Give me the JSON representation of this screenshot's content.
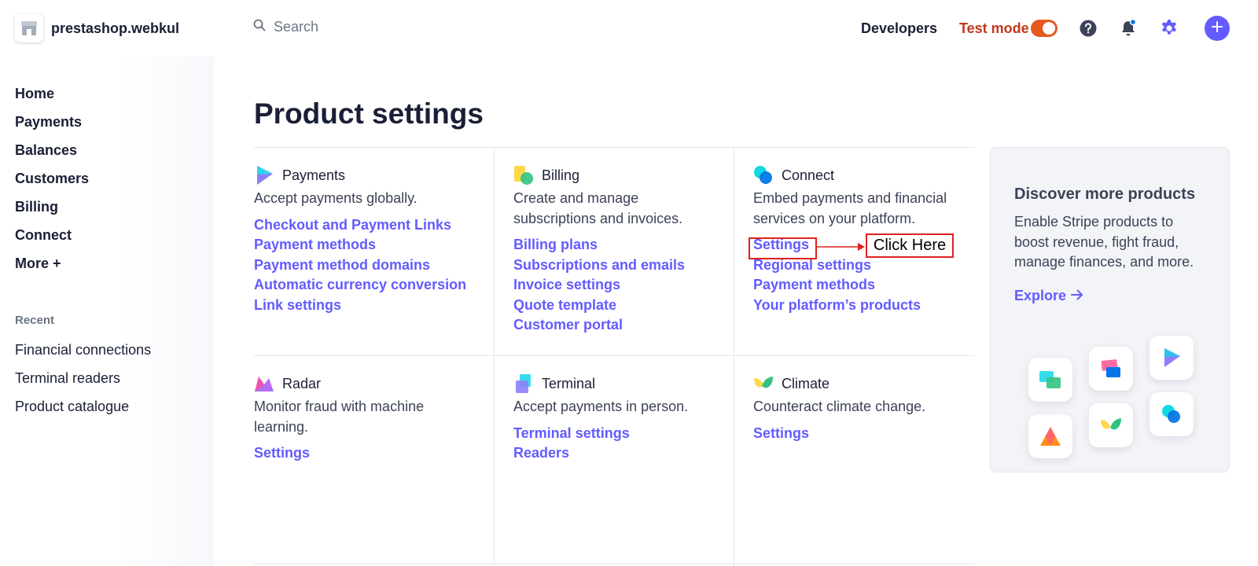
{
  "header": {
    "shop_name": "prestashop.webkul",
    "search_placeholder": "Search",
    "developers": "Developers",
    "test_mode": "Test mode"
  },
  "sidebar": {
    "items": [
      "Home",
      "Payments",
      "Balances",
      "Customers",
      "Billing",
      "Connect",
      "More +"
    ],
    "recent_label": "Recent",
    "recent": [
      "Financial connections",
      "Terminal readers",
      "Product catalogue"
    ]
  },
  "main": {
    "title": "Product settings",
    "cards": [
      {
        "name": "Payments",
        "desc": "Accept payments globally.",
        "links": [
          "Checkout and Payment Links",
          "Payment methods",
          "Payment method domains",
          "Automatic currency conversion",
          "Link settings"
        ]
      },
      {
        "name": "Billing",
        "desc": "Create and manage subscriptions and invoices.",
        "links": [
          "Billing plans",
          "Subscriptions and emails",
          "Invoice settings",
          "Quote template",
          "Customer portal"
        ]
      },
      {
        "name": "Connect",
        "desc": "Embed payments and financial services on your platform.",
        "links": [
          "Settings",
          "Regional settings",
          "Payment methods",
          "Your platform’s products"
        ]
      },
      {
        "name": "Radar",
        "desc": "Monitor fraud with machine learning.",
        "links": [
          "Settings"
        ]
      },
      {
        "name": "Terminal",
        "desc": "Accept payments in person.",
        "links": [
          "Terminal settings",
          "Readers"
        ]
      },
      {
        "name": "Climate",
        "desc": "Counteract climate change.",
        "links": [
          "Settings"
        ]
      }
    ]
  },
  "annotation": {
    "label": "Click Here",
    "color": "#e02020"
  },
  "discover": {
    "title": "Discover more products",
    "text": "Enable Stripe products to boost revenue, fight fraud, manage finances, and more.",
    "explore": "Explore"
  },
  "colors": {
    "accent": "#635bff",
    "test_mode": "#c1371b",
    "toggle": "#e5591e"
  },
  "icons": [
    "search-icon",
    "help-icon",
    "bell-icon",
    "gear-icon",
    "plus-icon",
    "arrow-right-icon",
    "store-icon"
  ]
}
